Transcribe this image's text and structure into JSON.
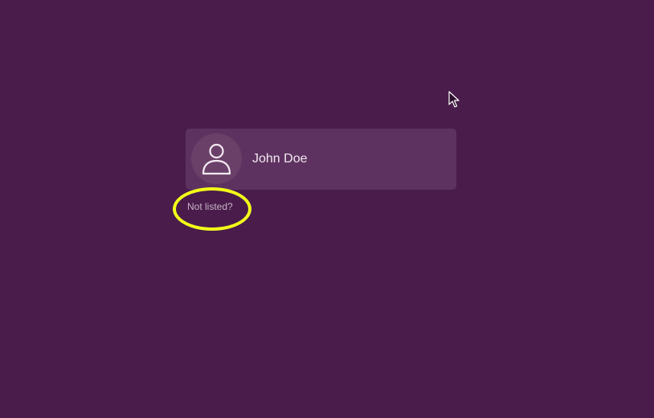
{
  "login": {
    "users": [
      {
        "name": "John Doe",
        "avatar_icon": "user-silhouette-icon"
      }
    ],
    "not_listed_label": "Not listed?"
  },
  "colors": {
    "background": "#4a1c4b",
    "card": "#5e3260",
    "avatar_bg": "#6a4069",
    "highlight": "#f3ff19"
  },
  "icons": {
    "cursor": "pointer-arrow-icon",
    "annotation": "highlight-circle"
  }
}
